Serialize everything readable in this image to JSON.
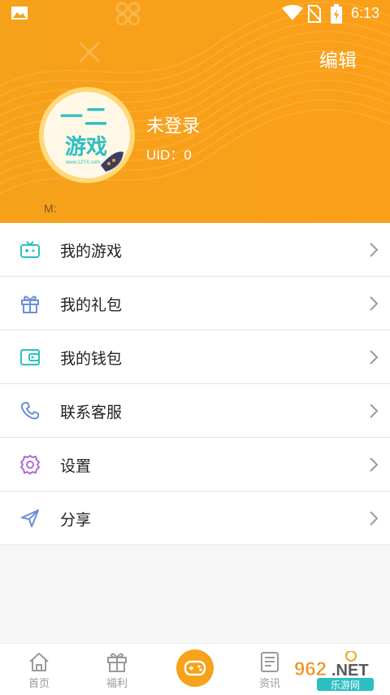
{
  "status_bar": {
    "time": "6:13"
  },
  "header": {
    "edit_label": "编辑",
    "username": "未登录",
    "uid_label": "UID：0",
    "m_label": "M:",
    "avatar_text": "一二",
    "avatar_text2": "游戏",
    "avatar_url": "www.12YX.com"
  },
  "menu": {
    "items": [
      {
        "label": "我的游戏",
        "icon": "gamepad-icon"
      },
      {
        "label": "我的礼包",
        "icon": "gift-icon"
      },
      {
        "label": "我的钱包",
        "icon": "wallet-icon"
      },
      {
        "label": "联系客服",
        "icon": "phone-icon"
      },
      {
        "label": "设置",
        "icon": "gear-icon"
      },
      {
        "label": "分享",
        "icon": "share-icon"
      }
    ]
  },
  "tabbar": {
    "tabs": [
      {
        "label": "首页",
        "icon": "home-icon"
      },
      {
        "label": "福利",
        "icon": "gift-icon"
      },
      {
        "label": "",
        "icon": "gamepad-icon"
      },
      {
        "label": "资讯",
        "icon": "news-icon"
      }
    ]
  },
  "watermark": {
    "text": "962.NET",
    "subtext": "乐游网"
  },
  "colors": {
    "accent": "#f7a21b",
    "icon_teal": "#2bbfc2",
    "icon_blue": "#6a8fd8",
    "icon_purple": "#b06ad6"
  }
}
